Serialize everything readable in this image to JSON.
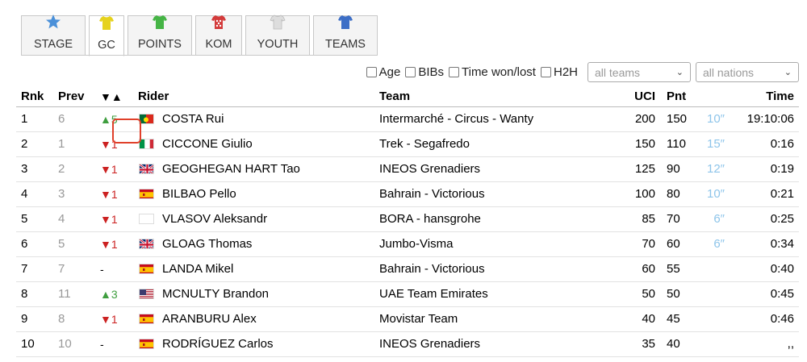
{
  "tabs": [
    {
      "label": "STAGE",
      "icon": "star-icon",
      "color": "#4a90d9"
    },
    {
      "label": "GC",
      "icon": "jersey-icon",
      "color": "#e6d21c"
    },
    {
      "label": "POINTS",
      "icon": "jersey-icon",
      "color": "#45b445"
    },
    {
      "label": "KOM",
      "icon": "jersey-icon",
      "color": "#d33a3a"
    },
    {
      "label": "YOUTH",
      "icon": "jersey-icon",
      "color": "#dddddd"
    },
    {
      "label": "TEAMS",
      "icon": "jersey-icon",
      "color": "#3c6ec6"
    }
  ],
  "active_tab": "GC",
  "filters": {
    "age": "Age",
    "bibs": "BIBs",
    "time": "Time won/lost",
    "h2h": "H2H",
    "teams_placeholder": "all teams",
    "nations_placeholder": "all nations"
  },
  "headers": {
    "rnk": "Rnk",
    "prev": "Prev",
    "delta": "▼▲",
    "rider": "Rider",
    "team": "Team",
    "uci": "UCI",
    "pnt": "Pnt",
    "time": "Time"
  },
  "rows": [
    {
      "rnk": "1",
      "prev": "6",
      "delta": "▲5",
      "dir": "up",
      "flag": "pt",
      "rider": "COSTA Rui",
      "team": "Intermarché - Circus - Wanty",
      "uci": "200",
      "pnt": "150",
      "bonus": "10″",
      "time": "19:10:06"
    },
    {
      "rnk": "2",
      "prev": "1",
      "delta": "▼1",
      "dir": "down",
      "flag": "it",
      "rider": "CICCONE Giulio",
      "team": "Trek - Segafredo",
      "uci": "150",
      "pnt": "110",
      "bonus": "15″",
      "time": "0:16"
    },
    {
      "rnk": "3",
      "prev": "2",
      "delta": "▼1",
      "dir": "down",
      "flag": "gb",
      "rider": "GEOGHEGAN HART Tao",
      "team": "INEOS Grenadiers",
      "uci": "125",
      "pnt": "90",
      "bonus": "12″",
      "time": "0:19"
    },
    {
      "rnk": "4",
      "prev": "3",
      "delta": "▼1",
      "dir": "down",
      "flag": "es",
      "rider": "BILBAO Pello",
      "team": "Bahrain - Victorious",
      "uci": "100",
      "pnt": "80",
      "bonus": "10″",
      "time": "0:21"
    },
    {
      "rnk": "5",
      "prev": "4",
      "delta": "▼1",
      "dir": "down",
      "flag": "blank",
      "rider": "VLASOV Aleksandr",
      "team": "BORA - hansgrohe",
      "uci": "85",
      "pnt": "70",
      "bonus": "6″",
      "time": "0:25"
    },
    {
      "rnk": "6",
      "prev": "5",
      "delta": "▼1",
      "dir": "down",
      "flag": "gb",
      "rider": "GLOAG Thomas",
      "team": "Jumbo-Visma",
      "uci": "70",
      "pnt": "60",
      "bonus": "6″",
      "time": "0:34"
    },
    {
      "rnk": "7",
      "prev": "7",
      "delta": "-",
      "dir": "none",
      "flag": "es",
      "rider": "LANDA Mikel",
      "team": "Bahrain - Victorious",
      "uci": "60",
      "pnt": "55",
      "bonus": "",
      "time": "0:40"
    },
    {
      "rnk": "8",
      "prev": "11",
      "delta": "▲3",
      "dir": "up",
      "flag": "us",
      "rider": "MCNULTY Brandon",
      "team": "UAE Team Emirates",
      "uci": "50",
      "pnt": "50",
      "bonus": "",
      "time": "0:45"
    },
    {
      "rnk": "9",
      "prev": "8",
      "delta": "▼1",
      "dir": "down",
      "flag": "es",
      "rider": "ARANBURU Alex",
      "team": "Movistar Team",
      "uci": "40",
      "pnt": "45",
      "bonus": "",
      "time": "0:46"
    },
    {
      "rnk": "10",
      "prev": "10",
      "delta": "-",
      "dir": "none",
      "flag": "es",
      "rider": "RODRÍGUEZ Carlos",
      "team": "INEOS Grenadiers",
      "uci": "35",
      "pnt": "40",
      "bonus": "",
      "time": ",,"
    }
  ]
}
